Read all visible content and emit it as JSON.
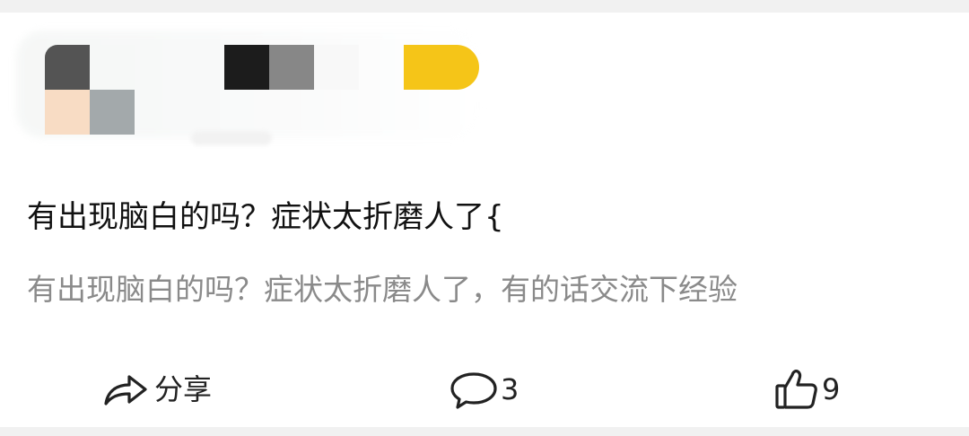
{
  "post": {
    "title": "有出现脑白的吗？症状太折磨人了{",
    "snippet": "有出现脑白的吗？症状太折磨人了，有的话交流下经验"
  },
  "actions": {
    "share": {
      "icon": "share-icon",
      "label": "分享"
    },
    "comment": {
      "icon": "comment-icon",
      "count": "3"
    },
    "like": {
      "icon": "thumbs-up-icon",
      "count": "9"
    }
  },
  "colors": {
    "page_bg": "#f1f1f1",
    "card_bg": "#ffffff",
    "title": "#111111",
    "snippet": "#8a8a8a",
    "badge": "#f5c518"
  }
}
